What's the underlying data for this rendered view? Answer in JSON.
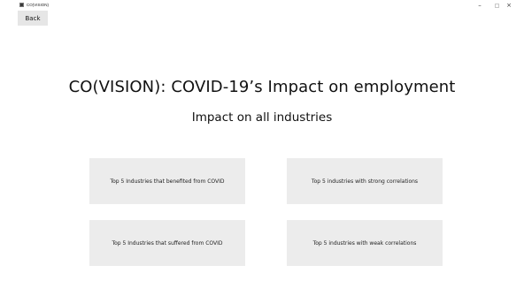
{
  "window": {
    "title": "CO(VISION)",
    "controls": {
      "minimize": "–",
      "close": "×"
    }
  },
  "nav": {
    "back_label": "Back"
  },
  "header": {
    "title": "CO(VISION): COVID-19’s Impact on employment",
    "subtitle": "Impact on all industries"
  },
  "options": {
    "benefited": "Top 5 Industries that benefited from COVID",
    "strong": "Top 5 industries with strong correlations",
    "suffered": "Top 5 Industries that suffered from COVID",
    "weak": "Top 5 industries with weak correlations"
  },
  "colors": {
    "background": "#ffffff",
    "button_bg": "#ececec",
    "back_button_bg": "#e6e6e6",
    "text": "#111111"
  }
}
